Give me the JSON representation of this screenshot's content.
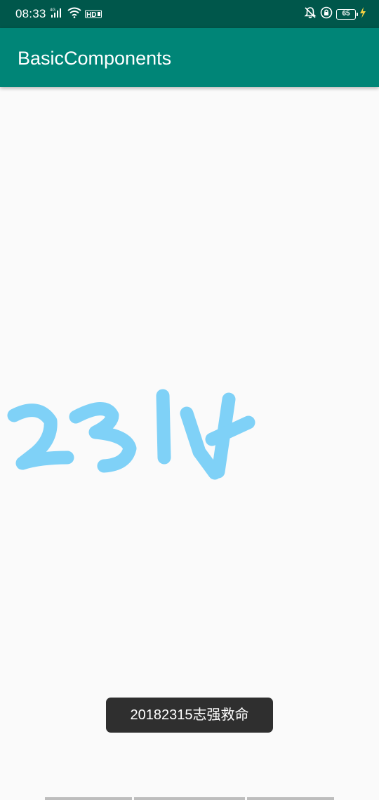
{
  "status_bar": {
    "time": "08:33",
    "network": "4G",
    "hd_label": "HD",
    "battery_level": "65",
    "icons": [
      "signal-icon",
      "wifi-icon",
      "hd-icon",
      "mute-icon",
      "rotation-lock-icon",
      "battery-icon",
      "charging-icon"
    ]
  },
  "app_bar": {
    "title": "BasicComponents"
  },
  "canvas": {
    "stroke_color": "#7fd1f7",
    "content": "drawn-handwriting"
  },
  "toast": {
    "message": "20182315志强救命"
  },
  "colors": {
    "status_bar": "#00574b",
    "app_bar": "#008577",
    "background": "#fafafa",
    "toast_bg": "#2f2f2f"
  }
}
